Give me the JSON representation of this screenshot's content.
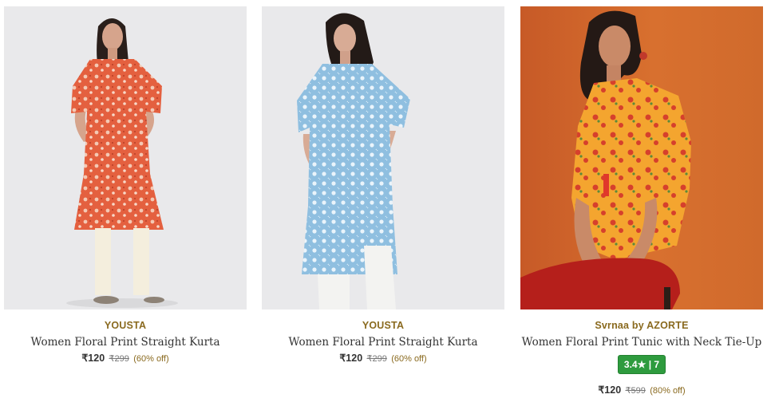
{
  "products": [
    {
      "brand": "YOUSTA",
      "title": "Women Floral Print Straight Kurta",
      "price": "₹120",
      "mrp": "₹299",
      "discount": "(60% off)",
      "image_icon": "orange-floral-kurta-image",
      "bg_color": "#e9e9eb"
    },
    {
      "brand": "YOUSTA",
      "title": "Women Floral Print Straight Kurta",
      "price": "₹120",
      "mrp": "₹299",
      "discount": "(60% off)",
      "image_icon": "blue-floral-kurta-image",
      "bg_color": "#e9e9eb"
    },
    {
      "brand": "Svrnaa by AZORTE",
      "title": "Women Floral Print Tunic with Neck Tie-Up",
      "rating": "3.4★ | 7",
      "price": "₹120",
      "mrp": "₹599",
      "discount": "(80% off)",
      "image_icon": "yellow-floral-tunic-image",
      "bg_color": "#d06a2c"
    }
  ],
  "colors": {
    "brand_text": "#8a6a1f",
    "rating_badge": "#2e9b3e"
  }
}
